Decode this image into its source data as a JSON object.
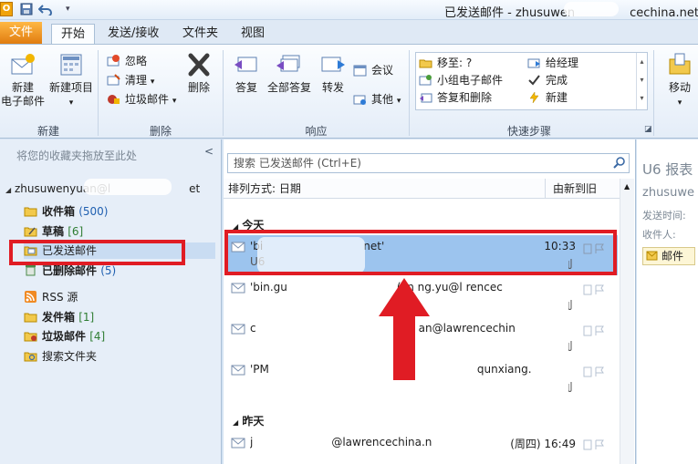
{
  "titlebar": {
    "window_title": "已发送邮件 - zhusuwen",
    "window_title_tail": "cechina.net"
  },
  "tabs": [
    {
      "label": "文件"
    },
    {
      "label": "开始"
    },
    {
      "label": "发送/接收"
    },
    {
      "label": "文件夹"
    },
    {
      "label": "视图"
    }
  ],
  "ribbon": {
    "groups": {
      "new": "新建",
      "delete": "删除",
      "respond": "响应",
      "quicksteps": "快速步骤",
      "move": "移动"
    },
    "new_email": "新建\n电子邮件",
    "new_item": "新建项目",
    "ignore": "忽略",
    "cleanup": "清理",
    "junk": "垃圾邮件",
    "delete_btn": "删除",
    "reply": "答复",
    "reply_all": "全部答复",
    "forward": "转发",
    "meeting": "会议",
    "more": "其他",
    "qs_move": "移至: ?",
    "qs_team": "小组电子邮件",
    "qs_reply_delete": "答复和删除",
    "qs_manager": "给经理",
    "qs_done": "完成",
    "qs_new": "新建",
    "move_btn": "移动"
  },
  "folderpane": {
    "hint": "将您的收藏夹拖放至此处",
    "collapse": "<",
    "account": "zhusuwenyuan@l",
    "account_tail": "et",
    "folders": [
      {
        "name": "收件箱",
        "count": "(500)"
      },
      {
        "name": "草稿",
        "count": "[6]"
      },
      {
        "name": "已发送邮件",
        "count": ""
      },
      {
        "name": "已删除邮件",
        "count": "(5)"
      },
      {
        "name": "RSS 源",
        "count": ""
      },
      {
        "name": "发件箱",
        "count": "[1]"
      },
      {
        "name": "垃圾邮件",
        "count": "[4]"
      },
      {
        "name": "搜索文件夹",
        "count": ""
      }
    ]
  },
  "maillist": {
    "search_placeholder": "搜索 已发送邮件 (Ctrl+E)",
    "sort_by": "排列方式: 日期",
    "sort_order": "由新到旧",
    "groups": [
      {
        "label": "今天"
      },
      {
        "label": "昨天"
      }
    ],
    "rows": [
      {
        "from": "'bi",
        "from_tail": "net'",
        "time": "10:33",
        "subject": "U6"
      },
      {
        "from": "'bin.gu",
        "from_tail": "(jin   ng.yu@l   rencec",
        "time": "",
        "subject": ""
      },
      {
        "from": "c",
        "from_tail": "an@lawrencechin",
        "time": "",
        "subject": ""
      },
      {
        "from": "'PM",
        "from_tail": "qunxiang.",
        "time": "",
        "subject": ""
      },
      {
        "from": "j",
        "from_tail": "@lawrencechina.n",
        "time": "(周四) 16:49",
        "subject": ""
      }
    ]
  },
  "readpane": {
    "title": "U6 报表",
    "from": "zhusuwe",
    "sent_label": "发送时间:",
    "to_label": "收件人:",
    "tag": "邮件"
  }
}
